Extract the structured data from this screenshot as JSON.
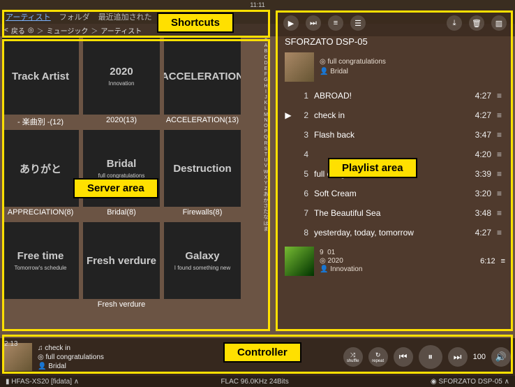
{
  "status": {
    "time": "11:11"
  },
  "tabs": {
    "items": [
      "アーティスト",
      "フォルダ",
      "最近追加された"
    ]
  },
  "breadcrumb": {
    "back": "戻る",
    "parts": [
      "ミュージック",
      "アーティスト"
    ]
  },
  "alpha_index": [
    "#",
    "A",
    "B",
    "C",
    "D",
    "E",
    "F",
    "G",
    "H",
    "I",
    "J",
    "K",
    "L",
    "M",
    "N",
    "O",
    "P",
    "Q",
    "R",
    "S",
    "T",
    "U",
    "V",
    "W",
    "X",
    "Y",
    "Z",
    "あ",
    "か",
    "さ",
    "た",
    "な",
    "は",
    "ま"
  ],
  "annot": {
    "shortcuts": "Shortcuts",
    "server": "Server area",
    "playlist": "Playlist area",
    "controller": "Controller"
  },
  "albums": [
    {
      "title": "Track Artist",
      "caption": "- 楽曲別 -(12)",
      "cls": "t0"
    },
    {
      "title": "2020",
      "caption": "2020(13)",
      "cls": "t1",
      "sub": "Innovation"
    },
    {
      "title": "ACCELERATION",
      "caption": "ACCELERATION(13)",
      "cls": "t2"
    },
    {
      "title": "ありがと",
      "caption": "APPRECIATION(8)",
      "cls": "t3"
    },
    {
      "title": "Bridal",
      "caption": "Bridal(8)",
      "cls": "t4",
      "sub": "full congratulations"
    },
    {
      "title": "Destruction",
      "caption": "Firewalls(8)",
      "cls": "t5"
    },
    {
      "title": "Free time",
      "caption": "",
      "cls": "t6",
      "sub": "Tomorrow's schedule"
    },
    {
      "title": "Fresh verdure",
      "caption": "Fresh verdure",
      "cls": "t7"
    },
    {
      "title": "Galaxy",
      "caption": "",
      "cls": "t8",
      "sub": "I found something new"
    }
  ],
  "playlist": {
    "device": "SFORZATO DSP-05",
    "album": "full congratulations",
    "artist": "Bridal",
    "tracks": [
      {
        "n": "1",
        "title": "ABROAD!",
        "dur": "4:27",
        "playing": false
      },
      {
        "n": "2",
        "title": "check in",
        "dur": "4:27",
        "playing": true
      },
      {
        "n": "3",
        "title": "Flash back",
        "dur": "3:47",
        "playing": false
      },
      {
        "n": "4",
        "title": "",
        "dur": "4:20",
        "playing": false
      },
      {
        "n": "5",
        "title": "full congratulations",
        "dur": "3:39",
        "playing": false
      },
      {
        "n": "6",
        "title": "Soft Cream",
        "dur": "3:20",
        "playing": false
      },
      {
        "n": "7",
        "title": "The Beautiful Sea",
        "dur": "3:48",
        "playing": false
      },
      {
        "n": "8",
        "title": "yesterday, today, tomorrow",
        "dur": "4:27",
        "playing": false
      }
    ],
    "extra": {
      "n": "9",
      "title": "01",
      "sub1": "2020",
      "sub2": "Innovation",
      "dur": "6:12"
    }
  },
  "controller": {
    "elapsed": "2:13",
    "track": "check in",
    "album": "full congratulations",
    "artist": "Bridal",
    "shuffle_icon": "⤨",
    "shuffle_label": "shuffle",
    "repeat_icon": "↻",
    "repeat_label": "repeat",
    "vol": "100"
  },
  "footer": {
    "left": "HFAS-XS20 [fidata]",
    "center": "FLAC 96.0KHz 24Bits",
    "right": "SFORZATO DSP-05"
  },
  "icons": {
    "disc": "◎",
    "person": "👤",
    "shuffle": "♫",
    "play": "▶",
    "now": "⏭",
    "next": "⏭",
    "edit": "≡",
    "menu": "☰",
    "save": "⤓",
    "delete": "🗑",
    "book": "▥",
    "prev": "⏮",
    "pause": "⏸",
    "nxt": "⏭",
    "vol": "🔊",
    "chev": "∧",
    "back": "<"
  }
}
